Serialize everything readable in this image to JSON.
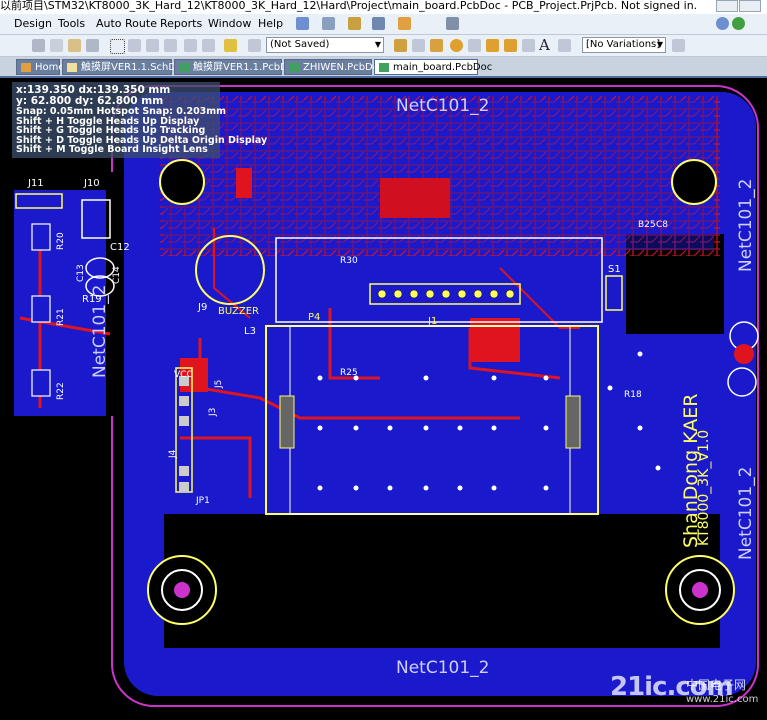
{
  "title_bar": {
    "text": "以前项目\\STM32\\KT8000_3K_Hard_12\\KT8000_3K_Hard_12\\Hard\\Project\\main_board.PcbDoc - PCB_Project.PrjPcb. Not signed in."
  },
  "menu": {
    "items": [
      {
        "label": "Design"
      },
      {
        "label": "Tools"
      },
      {
        "label": "Auto Route"
      },
      {
        "label": "Reports"
      },
      {
        "label": "Window"
      },
      {
        "label": "Help"
      }
    ]
  },
  "toolbar": {
    "saved_combo": "(Not Saved)",
    "variations_combo": "[No Variations]"
  },
  "tabs": [
    {
      "label": "Home",
      "active": false
    },
    {
      "label": "触摸屏VER1.1.SchDoc",
      "active": false
    },
    {
      "label": "触摸屏VER1.1.PcbDoc",
      "active": false
    },
    {
      "label": "ZHIWEN.PcbDoc",
      "active": false
    },
    {
      "label": "main_board.PcbDoc",
      "active": true
    }
  ],
  "hud": {
    "line1": "x:139.350   dx:139.350  mm",
    "line2": "y: 62.800    dy: 62.800  mm",
    "line3": "Snap: 0.05mm Hotspot Snap: 0.203mm",
    "line4": "Shift + H   Toggle Heads Up Display",
    "line5": "Shift + G   Toggle Heads Up Tracking",
    "line6": "Shift + D   Toggle Heads Up Delta Origin Display",
    "line7": "Shift + M   Toggle Board Insight Lens"
  },
  "pcb": {
    "net_labels": {
      "top": "NetC101_2",
      "bottom": "NetC101_2",
      "left": "NetC101_2",
      "right_top": "NetC101_2",
      "right_bottom": "NetC101_2"
    },
    "silkscreen": {
      "brand": "ShanDong KAER",
      "model": "KT8000_3K_V1.0",
      "j11": "J11",
      "j10": "J10",
      "j1": "J1",
      "j9": "J9",
      "p4": "P4",
      "s1": "S1",
      "buzzer": "BUZZER",
      "vcc": "VCC",
      "c12": "C12",
      "c13": "C13",
      "c14": "C14",
      "r19": "R19",
      "r20": "R20",
      "r21": "R21",
      "r22": "R22",
      "r30": "R30",
      "r25": "R25",
      "r18": "R18",
      "j3": "J3",
      "j4": "J4",
      "j5": "J5",
      "jp1": "JP1",
      "l3": "L3",
      "c8": "C8",
      "b25": "B25"
    },
    "colors": {
      "board_blue": "#1a1acc",
      "top_red": "#e0141e",
      "silk_yellow": "#ffff66",
      "keepout_magenta": "#cc33cc",
      "outline_white": "#ffffff",
      "background": "#000000"
    }
  },
  "watermark": {
    "logo": "21ic.com",
    "cn": "中国电子网",
    "url": "www.21ic.com"
  }
}
